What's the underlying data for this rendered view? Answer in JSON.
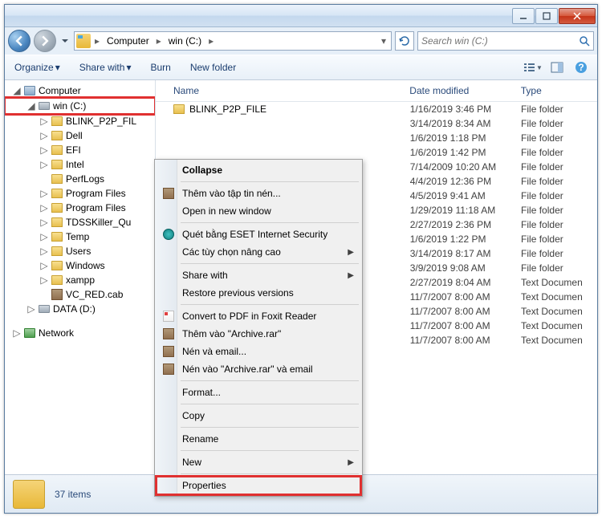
{
  "breadcrumb": {
    "computer": "Computer",
    "drive": "win (C:)"
  },
  "search": {
    "placeholder": "Search win (C:)"
  },
  "toolbar": {
    "organize": "Organize",
    "share": "Share with",
    "burn": "Burn",
    "newfolder": "New folder"
  },
  "columns": {
    "name": "Name",
    "date": "Date modified",
    "type": "Type"
  },
  "sidebar": {
    "computer": "Computer",
    "drive_c": "win (C:)",
    "drive_d": "DATA (D:)",
    "network": "Network",
    "items": [
      "BLINK_P2P_FIL",
      "Dell",
      "EFI",
      "Intel",
      "PerfLogs",
      "Program Files",
      "Program Files",
      "TDSSKiller_Qu",
      "Temp",
      "Users",
      "Windows",
      "xampp",
      "VC_RED.cab"
    ]
  },
  "files": [
    {
      "name": "BLINK_P2P_FILE",
      "date": "1/16/2019 3:46 PM",
      "type": "File folder"
    },
    {
      "name": "",
      "date": "3/14/2019 8:34 AM",
      "type": "File folder"
    },
    {
      "name": "",
      "date": "1/6/2019 1:18 PM",
      "type": "File folder"
    },
    {
      "name": "",
      "date": "1/6/2019 1:42 PM",
      "type": "File folder"
    },
    {
      "name": "",
      "date": "7/14/2009 10:20 AM",
      "type": "File folder"
    },
    {
      "name": "",
      "date": "4/4/2019 12:36 PM",
      "type": "File folder"
    },
    {
      "name": "",
      "date": "4/5/2019 9:41 AM",
      "type": "File folder"
    },
    {
      "name": "",
      "date": "1/29/2019 11:18 AM",
      "type": "File folder"
    },
    {
      "name": "",
      "date": "2/27/2019 2:36 PM",
      "type": "File folder"
    },
    {
      "name": "",
      "date": "1/6/2019 1:22 PM",
      "type": "File folder"
    },
    {
      "name": "",
      "date": "3/14/2019 8:17 AM",
      "type": "File folder"
    },
    {
      "name": "",
      "date": "3/9/2019 9:08 AM",
      "type": "File folder"
    },
    {
      "name": "",
      "date": "2/27/2019 8:04 AM",
      "type": "Text Documen"
    },
    {
      "name": "",
      "date": "11/7/2007 8:00 AM",
      "type": "Text Documen"
    },
    {
      "name": "",
      "date": "11/7/2007 8:00 AM",
      "type": "Text Documen"
    },
    {
      "name": "",
      "date": "11/7/2007 8:00 AM",
      "type": "Text Documen"
    },
    {
      "name": "",
      "date": "11/7/2007 8:00 AM",
      "type": "Text Documen"
    }
  ],
  "ctx": {
    "collapse": "Collapse",
    "addrar": "Thêm vào tập tin nén...",
    "opennew": "Open in new window",
    "eset": "Quét bằng ESET Internet Security",
    "advopts": "Các tùy chọn nâng cao",
    "sharewith": "Share with",
    "restore": "Restore previous versions",
    "pdf": "Convert to PDF in Foxit Reader",
    "addarch": "Thêm vào \"Archive.rar\"",
    "nenemail": "Nén và email...",
    "nenarch": "Nén vào \"Archive.rar\" và email",
    "format": "Format...",
    "copy": "Copy",
    "rename": "Rename",
    "new": "New",
    "properties": "Properties"
  },
  "status": {
    "count": "37 items"
  }
}
